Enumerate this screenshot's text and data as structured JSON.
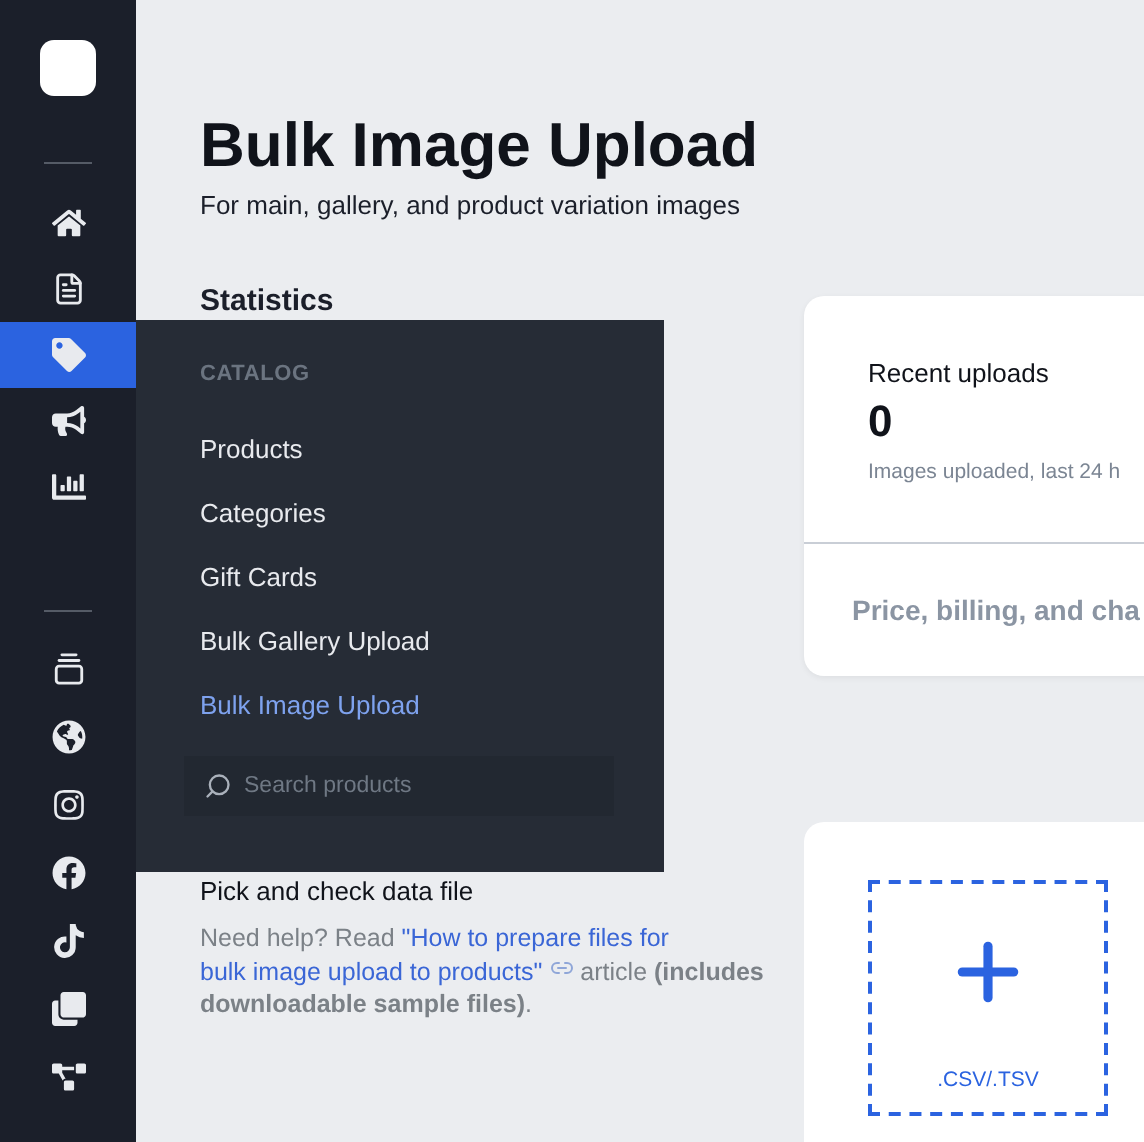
{
  "sidebar": {
    "groups": [
      {
        "items": [
          {
            "selected": false
          },
          {
            "selected": false
          },
          {
            "selected": true
          },
          {
            "selected": false
          },
          {
            "selected": false
          }
        ]
      },
      {
        "items": [
          {
            "selected": false
          },
          {
            "selected": false
          },
          {
            "selected": false
          },
          {
            "selected": false
          },
          {
            "selected": false
          },
          {
            "selected": false
          },
          {
            "selected": false
          }
        ]
      }
    ]
  },
  "header": {
    "title": "Bulk Image Upload",
    "subtitle": "For main, gallery, and product variation images"
  },
  "statistics": {
    "heading": "Statistics",
    "card": {
      "label": "Recent uploads",
      "value": "0",
      "caption": "Images uploaded, last 24 h",
      "footer": "Price, billing, and cha"
    }
  },
  "flyout": {
    "section": "CATALOG",
    "items": [
      {
        "label": "Products",
        "selected": false
      },
      {
        "label": "Categories",
        "selected": false
      },
      {
        "label": "Gift Cards",
        "selected": false
      },
      {
        "label": "Bulk Gallery Upload",
        "selected": false
      },
      {
        "label": "Bulk Image Upload",
        "selected": true
      }
    ],
    "search": {
      "placeholder": "Search products"
    }
  },
  "upload": {
    "heading": "Pick and check data file",
    "help_before": "Need help? Read ",
    "help_link_lines": [
      "\"How to prepare files for",
      "bulk image upload to products\""
    ],
    "help_after": " article **(includes downloadable sample files)**.",
    "dropzone_label": ".CSV/.TSV"
  }
}
